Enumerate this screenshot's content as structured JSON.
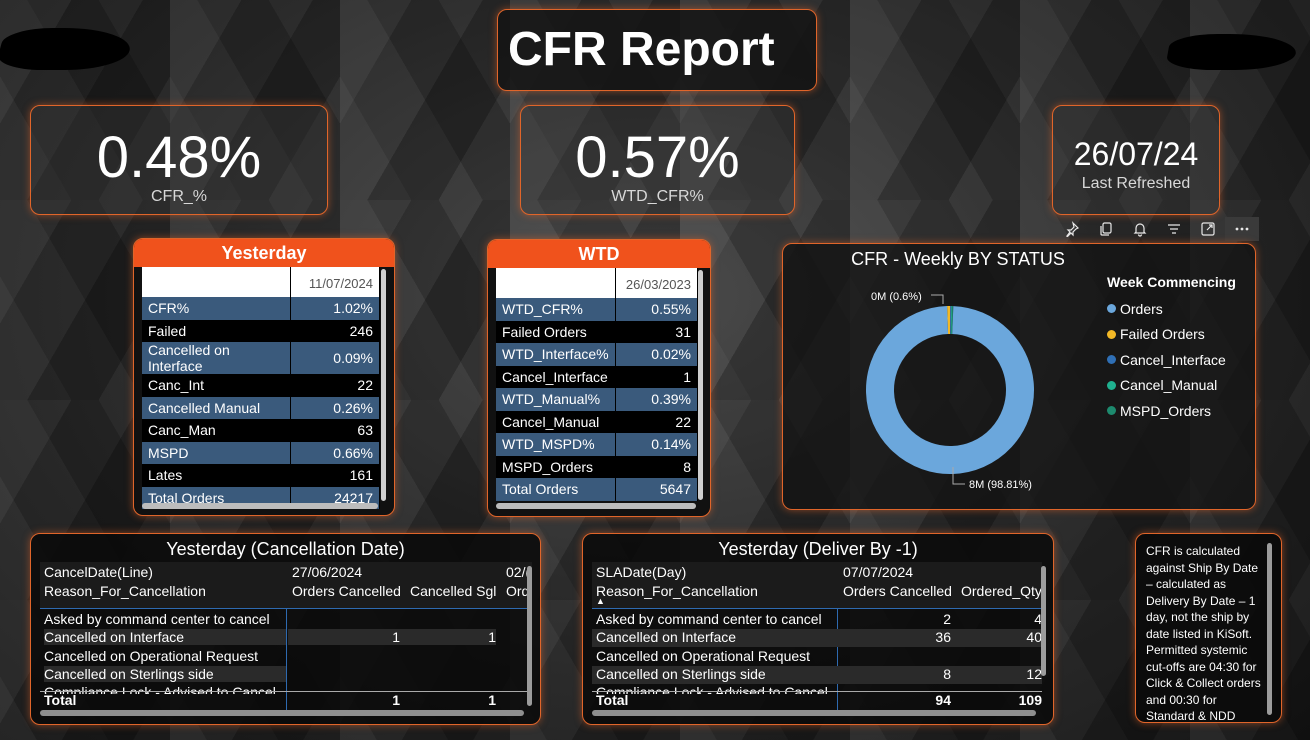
{
  "title": "CFR Report",
  "kpis": [
    {
      "value": "0.48%",
      "label": "CFR_%"
    },
    {
      "value": "0.57%",
      "label": "WTD_CFR%"
    }
  ],
  "refresh": {
    "date": "26/07/24",
    "label": "Last Refreshed"
  },
  "toolbar": {
    "icons": [
      "pin-icon",
      "copy-icon",
      "bell-icon",
      "filter-icon",
      "focus-mode-icon",
      "more-options-icon"
    ]
  },
  "yesterday": {
    "header": "Yesterday",
    "date_col": "11/07/2024",
    "rows": [
      {
        "label": "CFR%",
        "value": "1.02%"
      },
      {
        "label": "Failed",
        "value": "246"
      },
      {
        "label": "Cancelled on Interface",
        "value": "0.09%"
      },
      {
        "label": "Canc_Int",
        "value": "22"
      },
      {
        "label": "Cancelled Manual",
        "value": "0.26%"
      },
      {
        "label": "Canc_Man",
        "value": "63"
      },
      {
        "label": "MSPD",
        "value": "0.66%"
      },
      {
        "label": "Lates",
        "value": "161"
      },
      {
        "label": "Total Orders",
        "value": "24217"
      }
    ]
  },
  "wtd": {
    "header": "WTD",
    "date_col": "26/03/2023",
    "rows": [
      {
        "label": "WTD_CFR%",
        "value": "0.55%"
      },
      {
        "label": "Failed Orders",
        "value": "31"
      },
      {
        "label": "WTD_Interface%",
        "value": "0.02%"
      },
      {
        "label": "Cancel_Interface",
        "value": "1"
      },
      {
        "label": "WTD_Manual%",
        "value": "0.39%"
      },
      {
        "label": "Cancel_Manual",
        "value": "22"
      },
      {
        "label": "WTD_MSPD%",
        "value": "0.14%"
      },
      {
        "label": "MSPD_Orders",
        "value": "8"
      },
      {
        "label": "Total Orders",
        "value": "5647"
      }
    ]
  },
  "chart_data": {
    "type": "pie",
    "title": "CFR - Weekly BY STATUS",
    "legend_title": "Week Commencing",
    "legend_position": "right",
    "series": [
      {
        "name": "Orders",
        "value": 98.81,
        "label": "8M (98.81%)",
        "color": "#6ba7dc"
      },
      {
        "name": "Failed Orders",
        "value": 0.6,
        "label": "0M (0.6%)",
        "color": "#f2b826"
      },
      {
        "name": "Cancel_Interface",
        "value": 0.2,
        "color": "#2f6fb5"
      },
      {
        "name": "Cancel_Manual",
        "value": 0.2,
        "color": "#1fb08f"
      },
      {
        "name": "MSPD_Orders",
        "value": 0.19,
        "color": "#1d8a6e"
      }
    ]
  },
  "cancel_table": {
    "title": "Yesterday (Cancellation Date)",
    "row_header_1": "CancelDate(Line)",
    "row_header_2": "Reason_For_Cancellation",
    "date1": "27/06/2024",
    "date2": "02/(",
    "col1": "Orders Cancelled",
    "col2": "Cancelled Sgl",
    "col3": "Ord",
    "rows": [
      {
        "reason": "Asked by command center to cancel",
        "c1": "",
        "c2": ""
      },
      {
        "reason": "Cancelled on Interface",
        "c1": "1",
        "c2": "1"
      },
      {
        "reason": "Cancelled on Operational Request",
        "c1": "",
        "c2": ""
      },
      {
        "reason": "Cancelled on Sterlings side",
        "c1": "",
        "c2": ""
      },
      {
        "reason": "Compliance Lock - Advised to Cancel",
        "c1": "",
        "c2": ""
      }
    ],
    "total_label": "Total",
    "total_c1": "1",
    "total_c2": "1"
  },
  "deliver_table": {
    "title": "Yesterday (Deliver By -1)",
    "row_header_1": "SLADate(Day)",
    "row_header_2": "Reason_For_Cancellation",
    "date1": "07/07/2024",
    "col1": "Orders Cancelled",
    "col2": "Ordered_Qty",
    "rows": [
      {
        "reason": "Asked by command center to cancel",
        "c1": "2",
        "c2": "4"
      },
      {
        "reason": "Cancelled on Interface",
        "c1": "36",
        "c2": "40"
      },
      {
        "reason": "Cancelled on Operational Request",
        "c1": "",
        "c2": ""
      },
      {
        "reason": "Cancelled on Sterlings side",
        "c1": "8",
        "c2": "12"
      },
      {
        "reason": "Compliance Lock - Advised to Cancel",
        "c1": "",
        "c2": ""
      }
    ],
    "total_label": "Total",
    "total_c1": "94",
    "total_c2": "109"
  },
  "note": "CFR is calculated against Ship By Date – calculated as Delivery By Date – 1 day, not the ship by date listed in KiSoft. Permitted systemic cut-offs are 04:30 for Click & Collect orders and 00:30 for Standard & NDD"
}
